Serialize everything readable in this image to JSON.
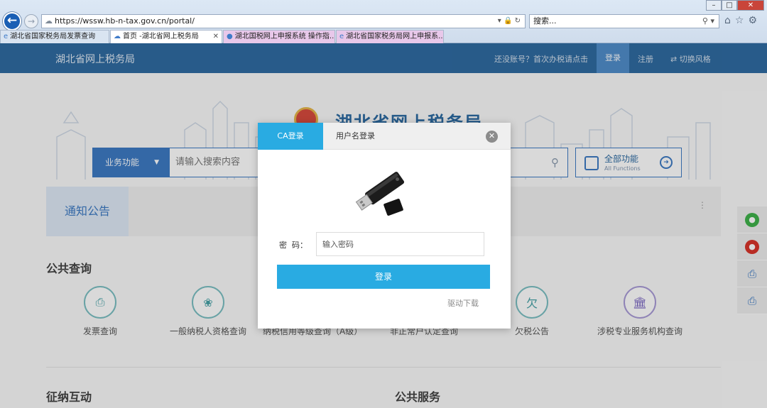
{
  "browser": {
    "url_host": "https://wssw.hb-n-tax.gov.cn",
    "url_path": "/portal/",
    "search_placeholder": "搜索...",
    "tabs": [
      {
        "label": "湖北省国家税务局发票查询"
      },
      {
        "label": "首页 -湖北省网上税务局"
      },
      {
        "label": "湖北国税网上申报系统 操作指..."
      },
      {
        "label": "湖北省国家税务局网上申报系..."
      }
    ]
  },
  "header": {
    "site_title": "湖北省网上税务局",
    "no_account_prompt": "还没账号？首次办税请点击",
    "login": "登录",
    "register": "注册",
    "switch_style": "切换风格"
  },
  "page": {
    "banner_title": "湖北省网上税务局",
    "func_select": "业务功能",
    "search_placeholder": "请输入搜索内容",
    "all_functions": "全部功能",
    "all_functions_en": "All Functions",
    "notice": "通知公告",
    "public_query_title": "公共查询",
    "services": [
      {
        "label": "发票查询"
      },
      {
        "label": "一般纳税人资格查询"
      },
      {
        "label": "纳税信用等级查询（A级）"
      },
      {
        "label": "非正常户认定查询"
      },
      {
        "label": "欠税公告"
      },
      {
        "label": "涉税专业服务机构查询"
      }
    ],
    "interaction_title": "征纳互动",
    "public_service_title": "公共服务"
  },
  "modal": {
    "tab_ca": "CA登录",
    "tab_username": "用户名登录",
    "password_label": "密  码：",
    "password_placeholder": "输入密码",
    "login_button": "登录",
    "driver_download": "驱动下载"
  },
  "colors": {
    "accent": "#29abe2",
    "header_bg": "#2c6aa2",
    "primary_blue": "#3e7bc4"
  }
}
